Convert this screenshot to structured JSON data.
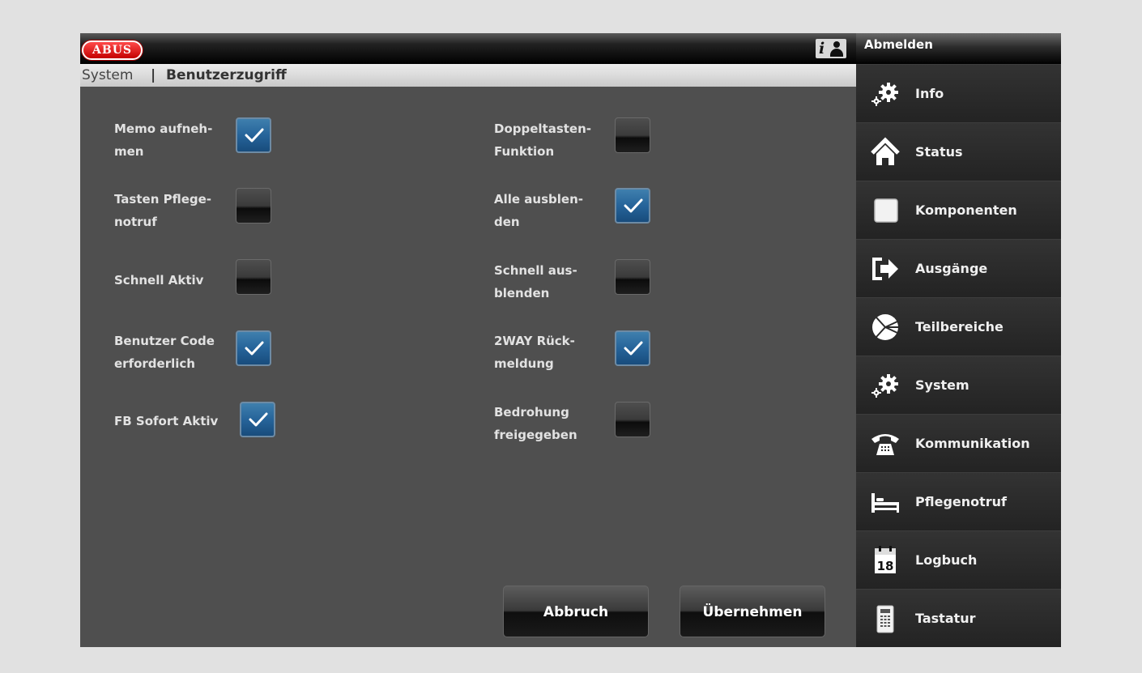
{
  "header": {
    "logo": "ABUS",
    "logout_label": "Abmelden"
  },
  "breadcrumb": {
    "root": "System",
    "separator": "|",
    "page": "Benutzerzugriff"
  },
  "options": [
    {
      "label_line1": "Memo aufneh-",
      "label_line2": "men",
      "checked": true
    },
    {
      "label_line1": "Tasten Pflege-",
      "label_line2": "notruf",
      "checked": false
    },
    {
      "label_line1": "Schnell Aktiv",
      "label_line2": "",
      "checked": false
    },
    {
      "label_line1": "Benutzer Code",
      "label_line2": "erforderlich",
      "checked": true
    },
    {
      "label_line1": "FB Sofort Aktiv",
      "label_line2": "",
      "checked": true
    },
    {
      "label_line1": "Doppeltasten-",
      "label_line2": "Funktion",
      "checked": false
    },
    {
      "label_line1": "Alle ausblen-",
      "label_line2": "den",
      "checked": true
    },
    {
      "label_line1": "Schnell aus-",
      "label_line2": "blenden",
      "checked": false
    },
    {
      "label_line1": "2WAY Rück-",
      "label_line2": "meldung",
      "checked": true
    },
    {
      "label_line1": "Bedrohung",
      "label_line2": "freigegeben",
      "checked": false
    }
  ],
  "actions": {
    "cancel_label": "Abbruch",
    "apply_label": "Übernehmen"
  },
  "sidebar": {
    "items": [
      {
        "label": "Info",
        "icon": "gears-icon"
      },
      {
        "label": "Status",
        "icon": "home-icon"
      },
      {
        "label": "Komponenten",
        "icon": "square-icon"
      },
      {
        "label": "Ausgänge",
        "icon": "exit-icon"
      },
      {
        "label": "Teilbereiche",
        "icon": "pie-icon"
      },
      {
        "label": "System",
        "icon": "gears-icon"
      },
      {
        "label": "Kommunikation",
        "icon": "telephone-icon"
      },
      {
        "label": "Pflegenotruf",
        "icon": "bed-icon"
      },
      {
        "label": "Logbuch",
        "icon": "calendar-icon",
        "icon_text": "18"
      },
      {
        "label": "Tastatur",
        "icon": "keypad-icon"
      }
    ]
  },
  "colors": {
    "page_bg": "#e1e1e1",
    "panel_bg": "#4f4f4f",
    "sidebar_bg": "#262626",
    "checked_blue": "#2a6aa0",
    "logo_red": "#d10000"
  }
}
